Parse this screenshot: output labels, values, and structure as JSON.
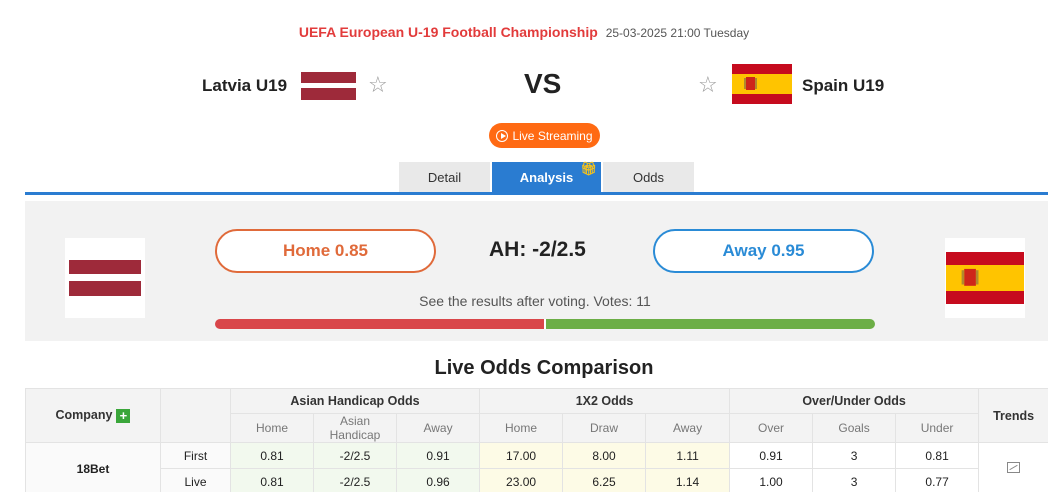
{
  "match": {
    "competition": "UEFA European U-19 Football Championship",
    "datetime": "25-03-2025 21:00 Tuesday",
    "home_team": "Latvia U19",
    "away_team": "Spain U19",
    "vs_label": "VS",
    "live_button": "Live Streaming"
  },
  "tabs": [
    {
      "label": "Detail",
      "active": false
    },
    {
      "label": "Analysis",
      "active": true
    },
    {
      "label": "Odds",
      "active": false
    }
  ],
  "vote": {
    "home_label": "Home 0.85",
    "away_label": "Away 0.95",
    "ah_label": "AH: -2/2.5",
    "note": "See the results after voting. Votes: 11",
    "home_share": 0.5,
    "colors": {
      "home": "#d9464a",
      "away": "#6cae46"
    }
  },
  "comparison": {
    "title": "Live Odds Comparison",
    "company_header": "Company",
    "groups": [
      "Asian Handicap Odds",
      "1X2 Odds",
      "Over/Under Odds"
    ],
    "trends_header": "Trends",
    "subheaders": [
      "Home",
      "Asian Handicap",
      "Away",
      "Home",
      "Draw",
      "Away",
      "Over",
      "Goals",
      "Under"
    ],
    "rows": [
      {
        "company": "18Bet",
        "lines": [
          {
            "type": "First",
            "values": [
              "0.81",
              "-2/2.5",
              "0.91",
              "17.00",
              "8.00",
              "1.11",
              "0.91",
              "3",
              "0.81"
            ]
          },
          {
            "type": "Live",
            "values": [
              "0.81",
              "-2/2.5",
              "0.96",
              "23.00",
              "6.25",
              "1.14",
              "1.00",
              "3",
              "0.77"
            ]
          }
        ]
      }
    ]
  },
  "icons": {
    "favorite": "star-outline-icon",
    "play": "play-circle-icon",
    "gift": "gift-icon",
    "add": "plus-icon",
    "trend": "trend-chart-icon"
  }
}
